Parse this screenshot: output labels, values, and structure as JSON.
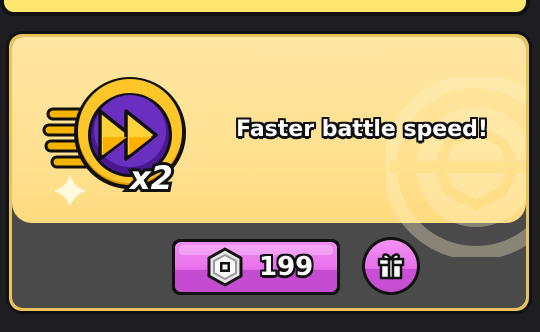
{
  "card": {
    "title": "Faster battle speed!",
    "badge": {
      "icon": "fast-forward-icon",
      "multiplier": "x2"
    }
  },
  "purchase": {
    "currency_icon": "robux-icon",
    "price": "199"
  },
  "gift": {
    "icon": "gift-icon"
  },
  "colors": {
    "card_bg": "#ffe08e",
    "card_bottom": "#4a4a4a",
    "button_pink": "#e870ee",
    "badge_purple": "#5a1fa0",
    "badge_gold": "#f5b400"
  }
}
